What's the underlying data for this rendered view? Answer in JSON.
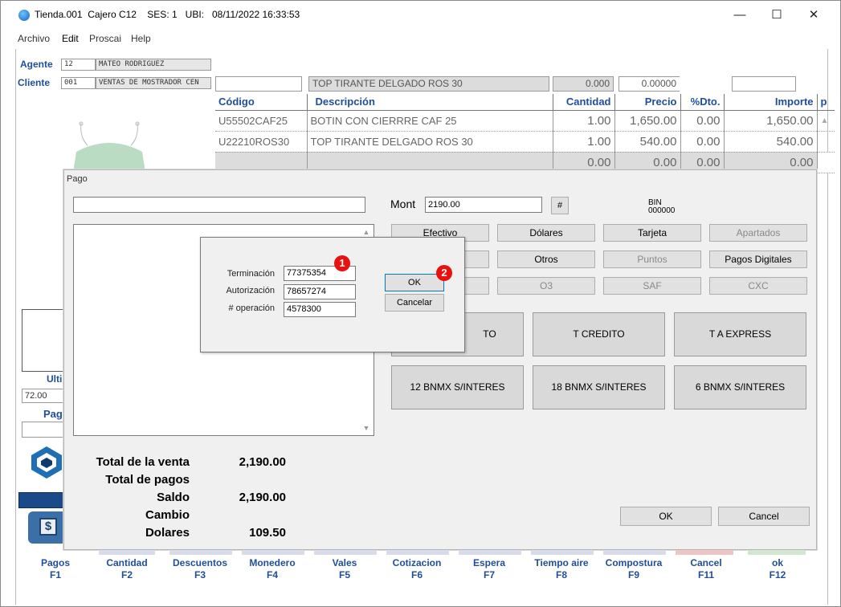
{
  "window": {
    "title": "Tienda.001  Cajero C12    SES: 1   UBI:   08/11/2022 16:33:53",
    "minimize": "—",
    "maximize": "☐",
    "close": "✕"
  },
  "menu": [
    "Archivo",
    "Edit",
    "Proscai",
    "Help"
  ],
  "header": {
    "agente_label": "Agente",
    "agente_code": "12",
    "agente_name": "MATEO RODRIGUEZ",
    "cliente_label": "Cliente",
    "cliente_code": "001",
    "cliente_name": "VENTAS DE MOSTRADOR CEN",
    "search_value": "",
    "desc_value": "TOP TIRANTE DELGADO ROS 30",
    "qty_value": "0.000",
    "price_value": "0.00000",
    "extra_value": ""
  },
  "grid": {
    "columns": [
      "Código",
      "Descripción",
      "Cantidad",
      "Precio",
      "%Dto.",
      "Importe",
      "p"
    ],
    "rows": [
      [
        "U55502CAF25",
        "BOTIN  CON CIERRRE CAF 25",
        "1.00",
        "1,650.00",
        "0.00",
        "1,650.00"
      ],
      [
        "U22210ROS30",
        "TOP TIRANTE DELGADO ROS 30",
        "1.00",
        "540.00",
        "0.00",
        "540.00"
      ],
      [
        "",
        "",
        "0.00",
        "0.00",
        "0.00",
        "0.00"
      ]
    ]
  },
  "left_panel": {
    "ulti_label": "Ulti",
    "ulti_value": "72.00",
    "pag_label": "Pag",
    "dollar": "$"
  },
  "pago": {
    "title": "Pago",
    "top_input": "",
    "mont_label": "Mont",
    "mont_value": "2190.00",
    "hash_button": "#",
    "bin_label": "BIN",
    "bin_value": "000000",
    "method_buttons": [
      {
        "label": "Efectivo",
        "enabled": true
      },
      {
        "label": "Dólares",
        "enabled": true
      },
      {
        "label": "Tarjeta",
        "enabled": true
      },
      {
        "label": "Apartados",
        "enabled": false
      },
      {
        "label": "",
        "enabled": true
      },
      {
        "label": "Otros",
        "enabled": true
      },
      {
        "label": "Puntos",
        "enabled": false
      },
      {
        "label": "Pagos Digitales",
        "enabled": true
      },
      {
        "label": "",
        "enabled": false
      },
      {
        "label": "O3",
        "enabled": false
      },
      {
        "label": "SAF",
        "enabled": false
      },
      {
        "label": "CXC",
        "enabled": false
      }
    ],
    "card_buttons": [
      "T DEBITO",
      "T CREDITO",
      "T A EXPRESS",
      "12 BNMX S/INTERES",
      "18 BNMX S/INTERES",
      "6 BNMX S/INTERES"
    ],
    "card_button_first_visible": "TO",
    "totals": [
      {
        "label": "Total de la venta",
        "value": "2,190.00"
      },
      {
        "label": "Total de pagos",
        "value": ""
      },
      {
        "label": "Saldo",
        "value": "2,190.00"
      },
      {
        "label": "Cambio",
        "value": ""
      },
      {
        "label": "Dolares",
        "value": "109.50"
      }
    ],
    "ok_label": "OK",
    "cancel_label": "Cancel"
  },
  "card_dialog": {
    "fields": [
      {
        "label": "Terminación",
        "value": "77375354"
      },
      {
        "label": "Autorización",
        "value": "78657274"
      },
      {
        "label": "# operación",
        "value": "4578300"
      }
    ],
    "ok_label": "OK",
    "cancel_label": "Cancelar",
    "badge1": "1",
    "badge2": "2"
  },
  "fkeys": [
    {
      "label": "Pagos",
      "key": "F1"
    },
    {
      "label": "Cantidad",
      "key": "F2"
    },
    {
      "label": "Descuentos",
      "key": "F3"
    },
    {
      "label": "Monedero",
      "key": "F4"
    },
    {
      "label": "Vales",
      "key": "F5"
    },
    {
      "label": "Cotizacion",
      "key": "F6"
    },
    {
      "label": "Espera",
      "key": "F7"
    },
    {
      "label": "Tiempo aire",
      "key": "F8"
    },
    {
      "label": "Compostura",
      "key": "F9"
    },
    {
      "label": "Cancel",
      "key": "F11"
    },
    {
      "label": "ok",
      "key": "F12"
    }
  ],
  "colors": {
    "label_blue": "#1f4e9a",
    "badge_red": "#e8110d"
  }
}
